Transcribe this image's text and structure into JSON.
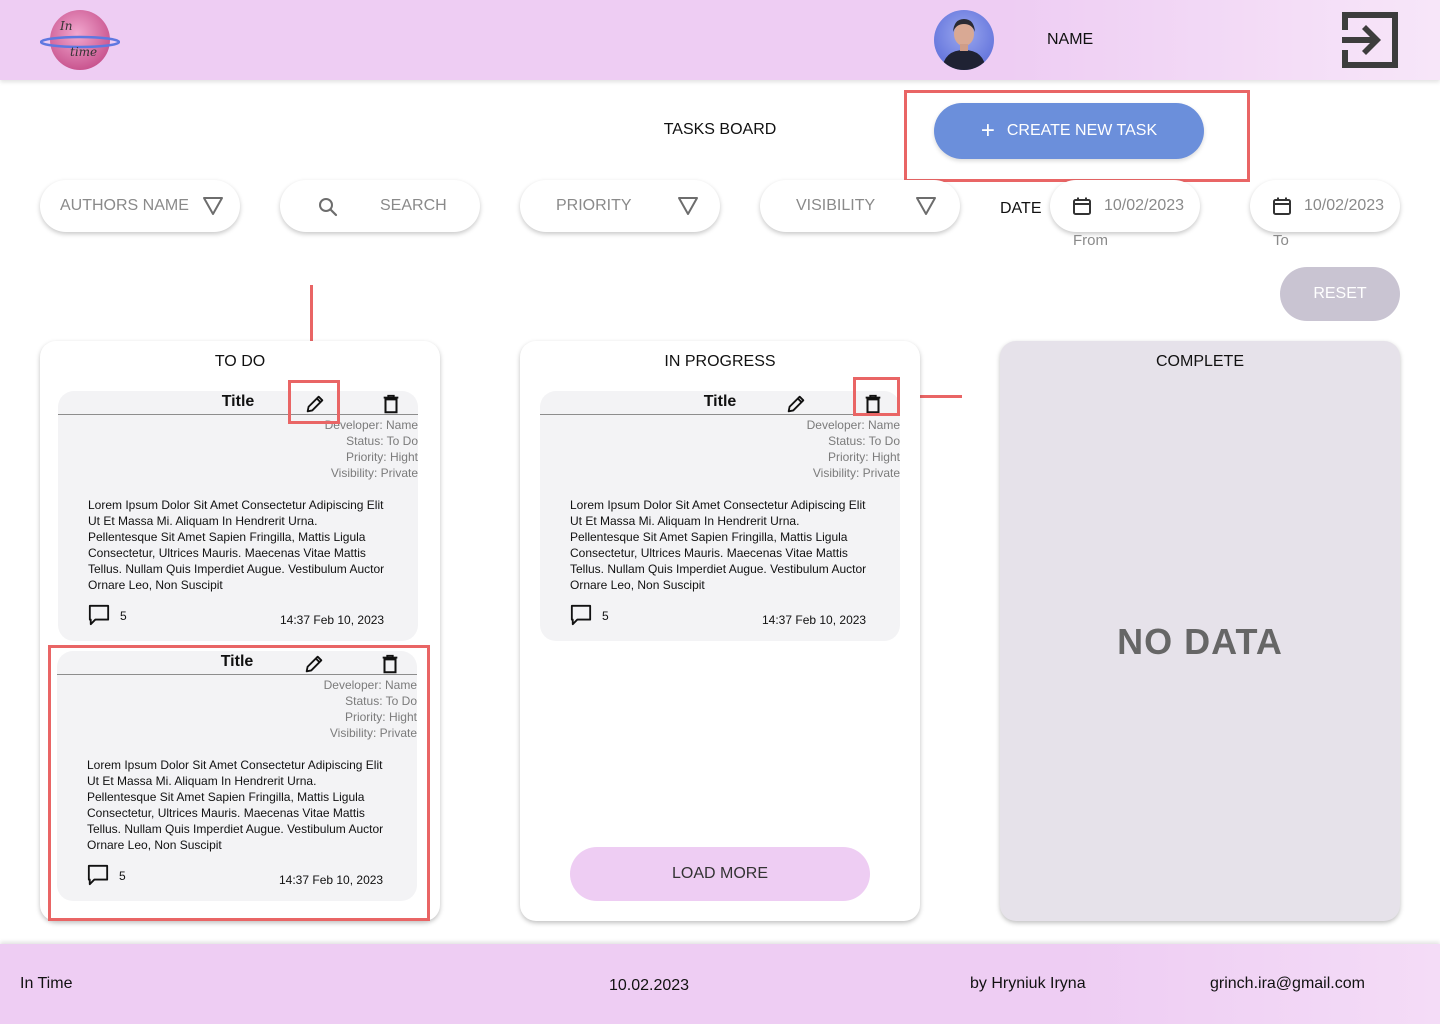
{
  "header": {
    "logo_text": "In time",
    "user_name": "NAME"
  },
  "board": {
    "title": "TASKS BOARD",
    "create_label": "CREATE NEW TASK"
  },
  "filters": {
    "authors_placeholder": "AUTHORS NAME",
    "search_placeholder": "SEARCH",
    "priority_placeholder": "PRIORITY",
    "visibility_placeholder": "VISIBILITY",
    "date_label": "DATE",
    "date_from": "10/02/2023",
    "date_from_caption": "From",
    "date_to": "10/02/2023",
    "date_to_caption": "To",
    "reset_label": "RESET"
  },
  "columns": {
    "todo": {
      "title": "TO DO",
      "cards": [
        {
          "title": "Title",
          "developer": "Developer: Name",
          "status": "Status: To Do",
          "priority": "Priority: Hight",
          "visibility": "Visibility: Private",
          "description": "Lorem Ipsum Dolor Sit Amet Consectetur Adipiscing Elit Ut Et Massa Mi. Aliquam In Hendrerit Urna. Pellentesque Sit Amet Sapien Fringilla, Mattis Ligula Consectetur, Ultrices Mauris. Maecenas Vitae Mattis Tellus. Nullam Quis Imperdiet Augue. Vestibulum Auctor Ornare Leo, Non Suscipit",
          "comments": "5",
          "time": "14:37 Feb 10, 2023"
        },
        {
          "title": "Title",
          "developer": "Developer: Name",
          "status": "Status: To Do",
          "priority": "Priority: Hight",
          "visibility": "Visibility: Private",
          "description": "Lorem Ipsum Dolor Sit Amet Consectetur Adipiscing Elit Ut Et Massa Mi. Aliquam In Hendrerit Urna. Pellentesque Sit Amet Sapien Fringilla, Mattis Ligula Consectetur, Ultrices Mauris. Maecenas Vitae Mattis Tellus. Nullam Quis Imperdiet Augue. Vestibulum Auctor Ornare Leo, Non Suscipit",
          "comments": "5",
          "time": "14:37 Feb 10, 2023"
        }
      ]
    },
    "in_progress": {
      "title": "IN PROGRESS",
      "cards": [
        {
          "title": "Title",
          "developer": "Developer: Name",
          "status": "Status: To Do",
          "priority": "Priority: Hight",
          "visibility": "Visibility: Private",
          "description": "Lorem Ipsum Dolor Sit Amet Consectetur Adipiscing Elit Ut Et Massa Mi. Aliquam In Hendrerit Urna. Pellentesque Sit Amet Sapien Fringilla, Mattis Ligula Consectetur, Ultrices Mauris. Maecenas Vitae Mattis Tellus. Nullam Quis Imperdiet Augue. Vestibulum Auctor Ornare Leo, Non Suscipit",
          "comments": "5",
          "time": "14:37 Feb 10, 2023"
        }
      ],
      "load_more_label": "LOAD MORE"
    },
    "complete": {
      "title": "COMPLETE",
      "empty_label": "NO DATA"
    }
  },
  "footer": {
    "app_name": "In Time",
    "date": "10.02.2023",
    "author": "by Hryniuk Iryna",
    "email": "grinch.ira@gmail.com"
  },
  "icons": {
    "logo": "planet-logo-icon",
    "logout": "logout-icon",
    "create": "plus-icon",
    "filter": "triangle-down-icon",
    "search": "search-icon",
    "calendar": "calendar-icon",
    "edit": "pencil-icon",
    "delete": "trash-icon",
    "comment": "comment-icon"
  },
  "colors": {
    "header_bg": "#eecdf3",
    "primary_button": "#6b8fdb",
    "reset_button": "#c9c4d2",
    "highlight": "#e96565",
    "card_bg": "#f3f3f5",
    "complete_bg": "#e6e2ea"
  }
}
